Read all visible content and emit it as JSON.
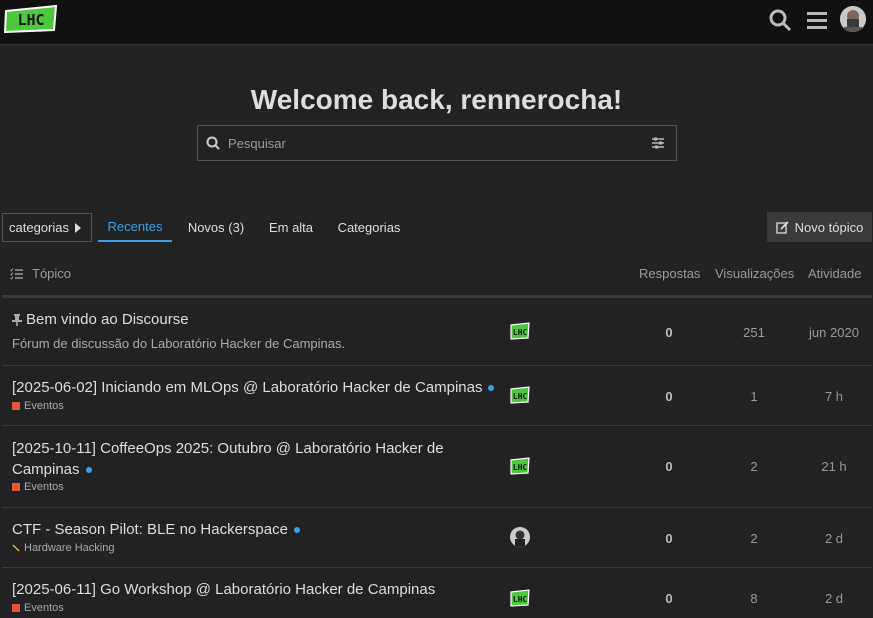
{
  "header": {
    "logo_icon": "lhc-logo-icon",
    "search_icon": "search-icon",
    "menu_icon": "hamburger-menu-icon",
    "avatar_icon": "user-avatar-icon"
  },
  "welcome": "Welcome back, rennerocha!",
  "search": {
    "placeholder": "Pesquisar"
  },
  "nav": {
    "categories_dropdown": "categorias",
    "tabs": [
      "Recentes",
      "Novos (3)",
      "Em alta",
      "Categorias"
    ],
    "active_tab": "Recentes",
    "new_topic": "Novo tópico"
  },
  "table": {
    "headers": {
      "topic": "Tópico",
      "replies": "Respostas",
      "views": "Visualizações",
      "activity": "Atividade"
    },
    "rows": [
      {
        "title": "Bem vindo ao Discourse",
        "pinned": true,
        "excerpt": "Fórum de discussão do Laboratório Hacker de Campinas.",
        "replies": "0",
        "views": "251",
        "activity": "jun 2020"
      },
      {
        "title": "[2025-06-02] Iniciando em MLOps @ Laboratório Hacker de Campinas",
        "unread": true,
        "category": "Eventos",
        "category_color": "#e45735",
        "replies": "0",
        "views": "1",
        "activity": "7 h"
      },
      {
        "title_line1": "[2025-10-11] CoffeeOps 2025: Outubro @ Laboratório Hacker de",
        "title_line2": "Campinas",
        "unread": true,
        "category": "Eventos",
        "category_color": "#e45735",
        "replies": "0",
        "views": "2",
        "activity": "21 h"
      },
      {
        "title": "CTF - Season Pilot: BLE no Hackerspace",
        "unread": true,
        "category": "Hardware Hacking",
        "category_color": "#f1a43c",
        "replies": "0",
        "views": "2",
        "activity": "2 d"
      },
      {
        "title": "[2025-06-11] Go Workshop @ Laboratório Hacker de Campinas",
        "category": "Eventos",
        "category_color": "#e45735",
        "replies": "0",
        "views": "8",
        "activity": "2 d"
      }
    ]
  },
  "colors": {
    "accent": "#3aa0e8",
    "logo_green": "#4cc83c",
    "background": "#222222"
  }
}
